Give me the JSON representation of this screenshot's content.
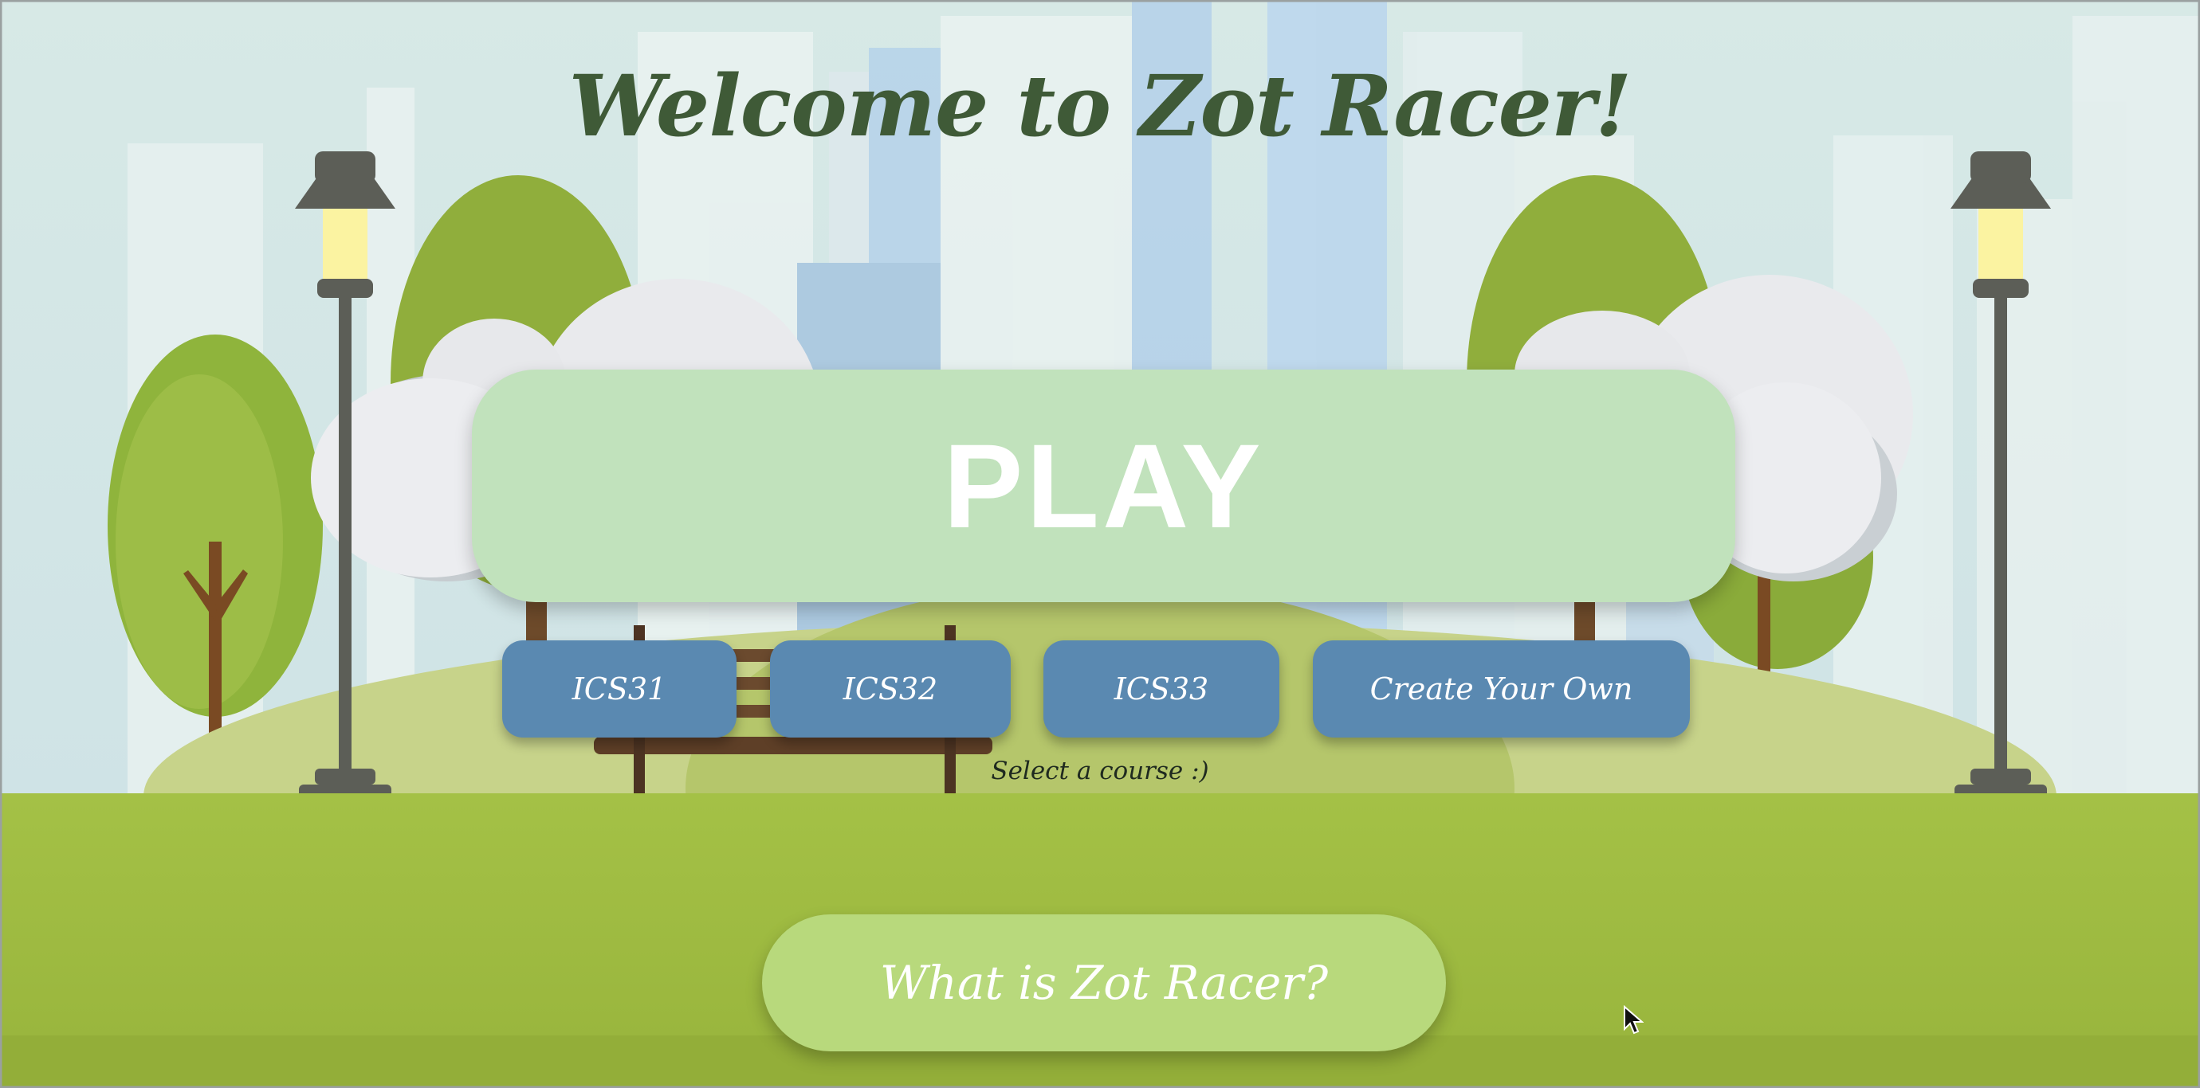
{
  "title": "Welcome to Zot Racer!",
  "play_button": {
    "label": "PLAY"
  },
  "courses": [
    {
      "label": "ICS31"
    },
    {
      "label": "ICS32"
    },
    {
      "label": "ICS33"
    },
    {
      "label": "Create Your Own"
    }
  ],
  "course_hint": "Select a course :)",
  "about_button": {
    "label": "What is Zot Racer?"
  },
  "colors": {
    "title": "#3f5a37",
    "play_button": "#c1e2bc",
    "course_button": "#5a89b1",
    "about_button": "#b8d97c",
    "grass": "#a2bf45",
    "sky": "#d4e6e4"
  }
}
